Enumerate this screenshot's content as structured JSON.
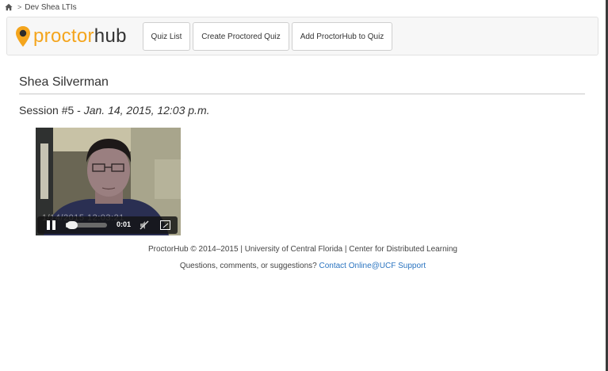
{
  "breadcrumb": {
    "home_icon": "home-icon",
    "separator": ">",
    "course": "Dev Shea LTIs"
  },
  "header": {
    "logo": {
      "proctor": "proctor",
      "hub": "hub",
      "icon": "location-pin-icon",
      "accent": "#f4a51d"
    },
    "nav": {
      "quiz_list": "Quiz List",
      "create_proctored_quiz": "Create Proctored Quiz",
      "add_proctorhub": "Add ProctorHub to Quiz"
    }
  },
  "main": {
    "student_name": "Shea Silverman",
    "session_prefix": "Session #5 - ",
    "session_date": "Jan. 14, 2015, 12:03 p.m."
  },
  "video": {
    "timestamp_overlay": "1/14/2015   12:03:21",
    "state": "playing",
    "time": "0:01",
    "progress": 0.06,
    "icons": {
      "pause": "pause-icon",
      "mute": "mute-icon",
      "fullscreen": "fullscreen-icon"
    }
  },
  "footer": {
    "line1": "ProctorHub © 2014–2015 | University of Central Florida | Center for Distributed Learning",
    "line2_prefix": "Questions, comments, or suggestions? ",
    "support_link": "Contact Online@UCF Support",
    "link_color": "#2a74c0"
  }
}
